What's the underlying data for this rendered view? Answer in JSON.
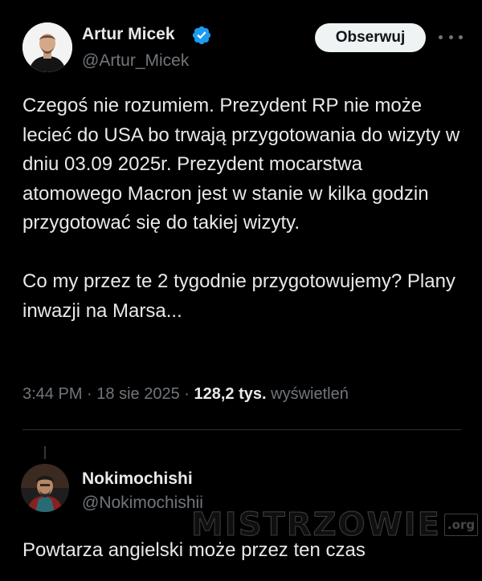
{
  "tweet": {
    "author": {
      "name": "Artur Micek",
      "handle": "@Artur_Micek",
      "verified": true
    },
    "follow_label": "Obserwuj",
    "more_icon": "more-horizontal-icon",
    "text_paragraphs": [
      "Czegoś nie rozumiem. Prezydent RP nie może lecieć do USA bo trwają przygotowania do wizyty w dniu 03.09 2025r. Prezydent mocarstwa atomowego Macron jest w stanie w kilka godzin przygotować się do takiej wizyty.",
      "Co my przez te 2 tygodnie przygotowujemy? Plany inwazji na Marsa..."
    ],
    "time": "3:44 PM",
    "separator": "·",
    "date": "18 sie 2025",
    "views_count": "128,2 tys.",
    "views_label": "wyświetleń"
  },
  "reply": {
    "author": {
      "name": "Nokimochishi",
      "handle": "@Nokimochishii"
    },
    "text": "Powtarza angielski może przez ten czas"
  },
  "watermark": {
    "text": "MISTRZOWIE",
    "suffix": ".org"
  },
  "colors": {
    "background": "#000000",
    "text_primary": "#e7e9ea",
    "text_secondary": "#71767b",
    "verified_blue": "#1d9bf0",
    "follow_button_bg": "#eff3f4",
    "divider": "#2f3336"
  }
}
